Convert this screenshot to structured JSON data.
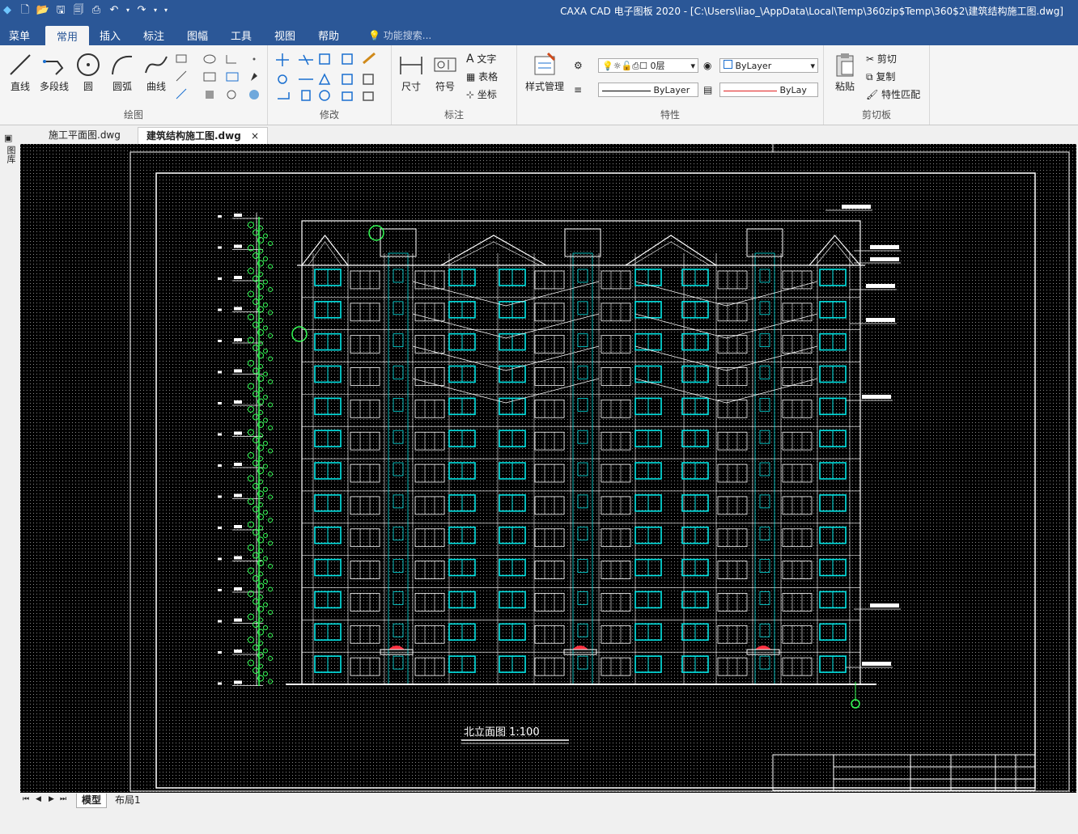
{
  "app": {
    "title": "CAXA CAD 电子图板 2020 - [C:\\Users\\liao_\\AppData\\Local\\Temp\\360zip$Temp\\360$2\\建筑结构施工图.dwg]"
  },
  "menu": {
    "items": [
      "菜单",
      "常用",
      "插入",
      "标注",
      "图幅",
      "工具",
      "视图",
      "帮助"
    ],
    "active": "常用",
    "search_placeholder": "功能搜索..."
  },
  "ribbon": {
    "draw": {
      "label": "绘图",
      "buttons": [
        "直线",
        "多段线",
        "圆",
        "圆弧",
        "曲线"
      ]
    },
    "modify": {
      "label": "修改"
    },
    "annotate": {
      "label": "标注",
      "buttons": [
        "尺寸",
        "符号"
      ],
      "small": [
        "文字",
        "表格",
        "坐标"
      ]
    },
    "properties": {
      "label": "特性",
      "style_button": "样式管理",
      "layer_value": "0层",
      "color_value": "ByLayer",
      "linetype_value": "ByLayer",
      "lineweight_value": "ByLay"
    },
    "clipboard": {
      "label": "剪切板",
      "paste": "粘贴",
      "cut": "剪切",
      "copy": "复制",
      "match": "特性匹配"
    }
  },
  "doc_tabs": [
    {
      "label": "施工平面图.dwg",
      "active": false
    },
    {
      "label": "建筑结构施工图.dwg",
      "active": true
    }
  ],
  "left_strip": {
    "label": "图库"
  },
  "drawing": {
    "caption": "北立面图  1:100"
  },
  "bottom_tabs": [
    {
      "label": "模型",
      "active": true
    },
    {
      "label": "布局1",
      "active": false
    }
  ],
  "colors": {
    "titlebar": "#2b5797",
    "canvas": "#000000",
    "line_white": "#ffffff",
    "window_cyan": "#00e5e5",
    "tree_green": "#33ff55",
    "accent_red": "#ff3040"
  }
}
